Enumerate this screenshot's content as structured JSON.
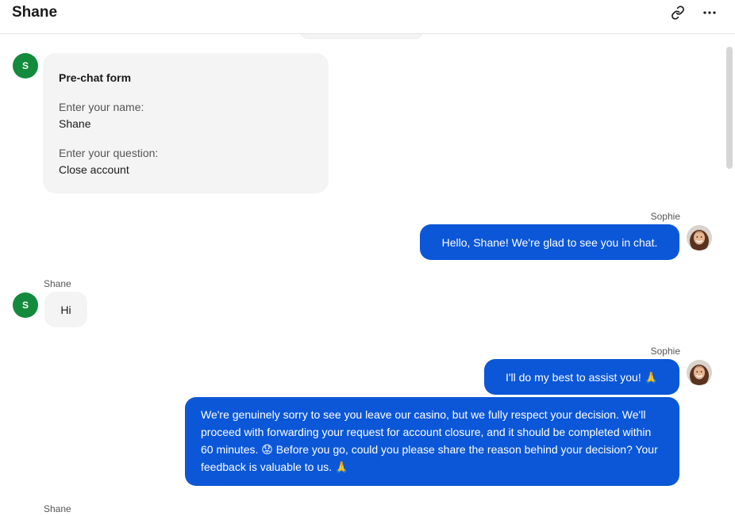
{
  "header": {
    "title": "Shane",
    "link_icon": "link-icon",
    "more_icon": "more-horizontal-icon"
  },
  "colors": {
    "agent_bubble": "#0b57d8",
    "visitor_bubble": "#f4f4f4",
    "visitor_avatar": "#148a3c"
  },
  "form": {
    "title": "Pre-chat form",
    "fields": [
      {
        "label": "Enter your name:",
        "value": "Shane"
      },
      {
        "label": "Enter your question:",
        "value": "Close account"
      }
    ]
  },
  "visitor": {
    "name": "Shane",
    "initial": "S"
  },
  "agent": {
    "name": "Sophie"
  },
  "messages": [
    {
      "sender": "Sophie",
      "text": "Hello, Shane! We're glad to see you in chat."
    },
    {
      "sender": "Shane",
      "text": "Hi"
    },
    {
      "sender": "Sophie",
      "text": "I'll do my best to assist you! 🙏"
    },
    {
      "sender": "Sophie",
      "text": "We're genuinely sorry to see you leave our casino, but we fully respect your decision. We'll proceed with forwarding your request for account closure, and it should be completed within 60 minutes. 😟 Before you go, could you please share the reason behind your decision? Your feedback is valuable to us. 🙏"
    }
  ],
  "trailing_sender": "Shane"
}
